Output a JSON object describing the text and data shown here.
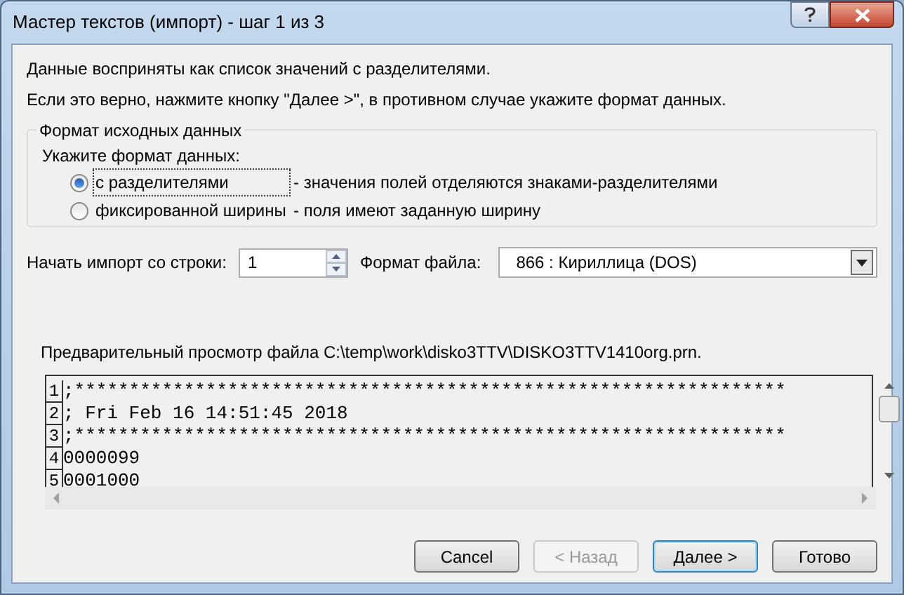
{
  "window": {
    "title": "Мастер текстов (импорт) - шаг 1 из 3"
  },
  "intro": [
    "Данные восприняты как список значений с разделителями.",
    "Если это верно, нажмите кнопку \"Далее >\", в противном случае укажите формат данных."
  ],
  "source_format": {
    "legend": "Формат исходных данных",
    "prompt": "Укажите формат данных:",
    "options": [
      {
        "label": "с разделителями",
        "description": "- значения полей отделяются знаками-разделителями",
        "selected": true
      },
      {
        "label": "фиксированной ширины",
        "description": "- поля имеют заданную ширину",
        "selected": false
      }
    ]
  },
  "start_row": {
    "label": "Начать импорт со строки:",
    "value": "1"
  },
  "file_format": {
    "label": "Формат файла:",
    "value": "866 : Кириллица (DOS)"
  },
  "preview": {
    "label": "Предварительный просмотр файла C:\\temp\\work\\disko3TTV\\DISKO3TTV1410org.prn.",
    "rows": [
      {
        "number": "1",
        "text": ";*****************************************************************"
      },
      {
        "number": "2",
        "text": "; Fri Feb 16 14:51:45 2018"
      },
      {
        "number": "3",
        "text": ";*****************************************************************"
      },
      {
        "number": "4",
        "text": "0000099"
      },
      {
        "number": "5",
        "text": "0001000"
      }
    ]
  },
  "buttons": [
    {
      "label": "Cancel",
      "disabled": false,
      "default": false
    },
    {
      "label": "< Назад",
      "disabled": true,
      "default": false
    },
    {
      "label": "Далее >",
      "disabled": false,
      "default": true
    },
    {
      "label": "Готово",
      "disabled": false,
      "default": false
    }
  ]
}
